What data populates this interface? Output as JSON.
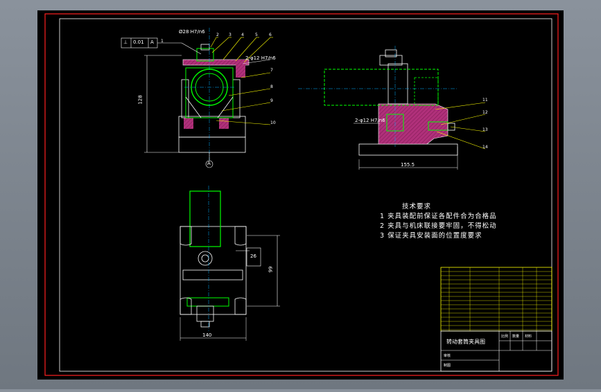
{
  "dimensions": {
    "top_fit": "Ø28 H7/n6",
    "height": "128",
    "fit_right": "2-φ12 H7/n6",
    "length": "155.5",
    "width": "140",
    "vertical_right": "99",
    "small_box": "26"
  },
  "tolerance_frame": {
    "symbol": "⊥",
    "value": "0.01",
    "datum": "A"
  },
  "datum_label": "A",
  "part_callouts": [
    "1",
    "2",
    "3",
    "4",
    "5",
    "6",
    "7",
    "8",
    "9",
    "10",
    "11",
    "12",
    "13",
    "14"
  ],
  "technical_notes": {
    "title": "技术要求",
    "items": [
      "1  夹具装配前保证各配件合为合格品",
      "2  夹具与机床联接要牢固，不得松动",
      "3  保证夹具安装面的位置度要求"
    ]
  },
  "title_block": {
    "drawing_title": "转动套筒夹具图",
    "cells": [
      "比例",
      "数量",
      "材料",
      "审核",
      "制图"
    ]
  },
  "colors": {
    "background": "#000000",
    "outer_frame": "#ff2020",
    "border": "#ffffff",
    "part_outline": "#00ff00",
    "section_fill": "#b0307a",
    "callouts": "#ffff00",
    "centerline": "#00b0ff"
  }
}
